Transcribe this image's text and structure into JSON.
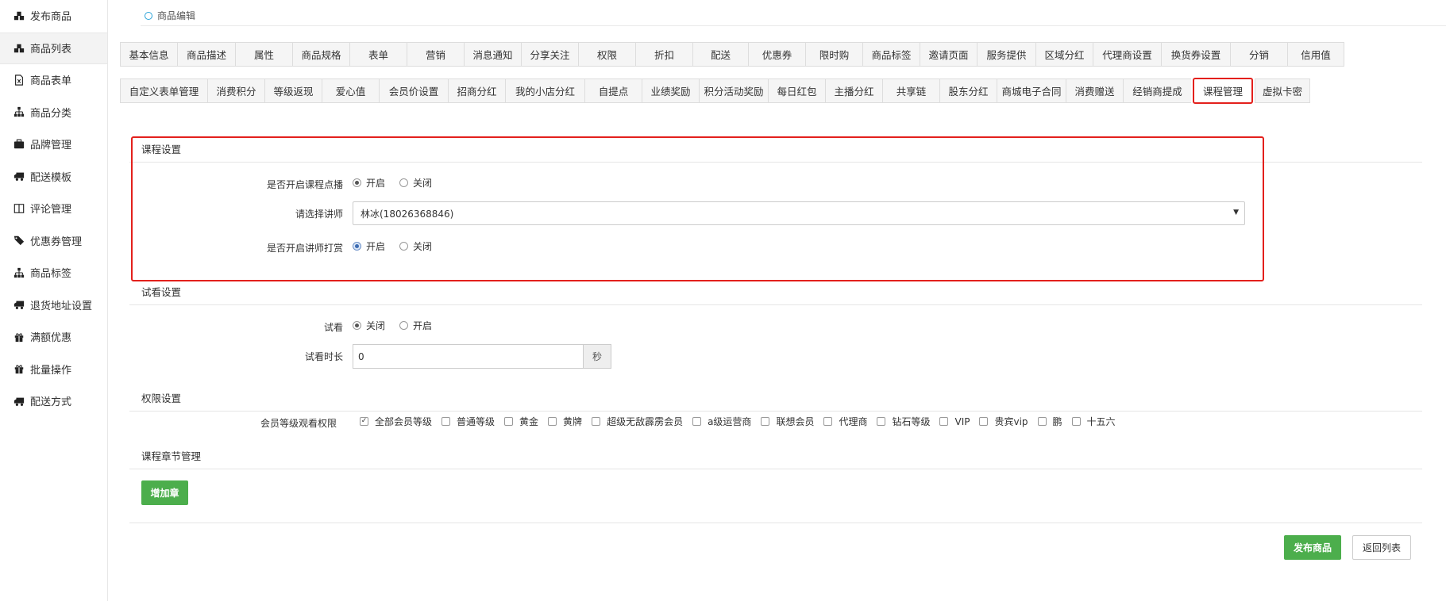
{
  "sidebar": {
    "items": [
      {
        "label": "发布商品",
        "icon": "cubes-icon"
      },
      {
        "label": "商品列表",
        "icon": "cubes-icon"
      },
      {
        "label": "商品表单",
        "icon": "file-excel-icon"
      },
      {
        "label": "商品分类",
        "icon": "sitemap-icon"
      },
      {
        "label": "品牌管理",
        "icon": "briefcase-icon"
      },
      {
        "label": "配送模板",
        "icon": "truck-icon"
      },
      {
        "label": "评论管理",
        "icon": "columns-icon"
      },
      {
        "label": "优惠券管理",
        "icon": "tags-icon"
      },
      {
        "label": "商品标签",
        "icon": "sitemap-icon"
      },
      {
        "label": "退货地址设置",
        "icon": "truck-icon"
      },
      {
        "label": "满额优惠",
        "icon": "gift-icon"
      },
      {
        "label": "批量操作",
        "icon": "gift-icon"
      },
      {
        "label": "配送方式",
        "icon": "truck-icon"
      }
    ]
  },
  "page": {
    "title": "商品编辑"
  },
  "tabs_row1": [
    "基本信息",
    "商品描述",
    "属性",
    "商品规格",
    "表单",
    "营销",
    "消息通知",
    "分享关注",
    "权限",
    "折扣",
    "配送",
    "优惠券",
    "限时购",
    "商品标签",
    "邀请页面",
    "服务提供",
    "区域分红",
    "代理商设置",
    "换货券设置",
    "分销",
    "信用值"
  ],
  "tabs_row2": [
    "自定义表单管理",
    "消费积分",
    "等级返现",
    "爱心值",
    "会员价设置",
    "招商分红",
    "我的小店分红",
    "自提点",
    "业绩奖励",
    "积分活动奖励",
    "每日红包",
    "主播分红",
    "共享链",
    "股东分红",
    "商城电子合同",
    "消费赠送",
    "经销商提成",
    "课程管理",
    "虚拟卡密"
  ],
  "course": {
    "section_title": "课程设置",
    "enable_label": "是否开启课程点播",
    "enable_options": [
      "开启",
      "关闭"
    ],
    "teacher_label": "请选择讲师",
    "teacher_value": "林冰(18026368846)",
    "reward_label": "是否开启讲师打赏",
    "reward_options": [
      "开启",
      "关闭"
    ]
  },
  "trial": {
    "section_title": "试看设置",
    "trial_label": "试看",
    "trial_options": [
      "关闭",
      "开启"
    ],
    "duration_label": "试看时长",
    "duration_value": "0",
    "duration_unit": "秒"
  },
  "permission": {
    "section_title": "权限设置",
    "levels_label": "会员等级观看权限",
    "levels": [
      {
        "label": "全部会员等级",
        "checked": true
      },
      {
        "label": "普通等级",
        "checked": false
      },
      {
        "label": "黄金",
        "checked": false
      },
      {
        "label": "黄牌",
        "checked": false
      },
      {
        "label": "超级无敌霹雳会员",
        "checked": false
      },
      {
        "label": "a级运营商",
        "checked": false
      },
      {
        "label": "联想会员",
        "checked": false
      },
      {
        "label": "代理商",
        "checked": false
      },
      {
        "label": "钻石等级",
        "checked": false
      },
      {
        "label": "VIP",
        "checked": false
      },
      {
        "label": "贵宾vip",
        "checked": false
      },
      {
        "label": "鹏",
        "checked": false
      },
      {
        "label": "十五六",
        "checked": false
      }
    ]
  },
  "chapters": {
    "section_title": "课程章节管理",
    "add_label": "增加章"
  },
  "footer": {
    "publish_label": "发布商品",
    "back_label": "返回列表"
  },
  "colors": {
    "accent_green": "#4cae4c",
    "highlight_red": "#e3201c",
    "title_dot": "#2aa3d8"
  }
}
